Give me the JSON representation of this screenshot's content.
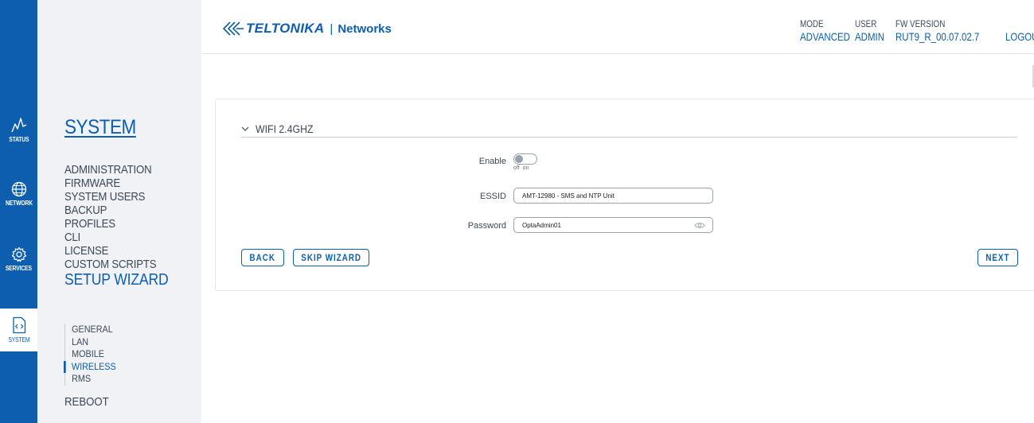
{
  "rail": {
    "items": [
      {
        "label": "STATUS",
        "icon": "status-icon"
      },
      {
        "label": "NETWORK",
        "icon": "globe-icon"
      },
      {
        "label": "SERVICES",
        "icon": "gear-icon"
      },
      {
        "label": "SYSTEM",
        "icon": "code-icon"
      }
    ],
    "active": "SYSTEM",
    "color": "#0d5eaf"
  },
  "sidenav": {
    "title": "SYSTEM",
    "items": [
      "ADMINISTRATION",
      "FIRMWARE",
      "SYSTEM USERS",
      "BACKUP",
      "PROFILES",
      "CLI",
      "LICENSE",
      "CUSTOM SCRIPTS"
    ],
    "active_item": "SETUP WIZARD",
    "subitems": [
      "GENERAL",
      "LAN",
      "MOBILE",
      "WIRELESS",
      "RMS"
    ],
    "active_subitem": "WIRELESS",
    "after": "REBOOT"
  },
  "header": {
    "brand": "TELTONIKA",
    "separator": "|",
    "product": "Networks",
    "mode_label": "MODE",
    "mode_value": "ADVANCED",
    "user_label": "USER",
    "user_value": "ADMIN",
    "fw_label": "FW VERSION",
    "fw_value": "RUT9_R_00.07.02.7",
    "logout_label": "LOGOUT"
  },
  "section": {
    "title": "WIFI 2.4GHZ",
    "enable_label": "Enable",
    "enable_off": "off",
    "enable_on": "on",
    "enabled": false,
    "essid_label": "ESSID",
    "essid_value": "AMT-12980 - SMS and NTP Unit",
    "password_label": "Password",
    "password_value": "OptaAdmin01"
  },
  "buttons": {
    "back": "BACK",
    "skip": "SKIP WIZARD",
    "next": "NEXT"
  }
}
